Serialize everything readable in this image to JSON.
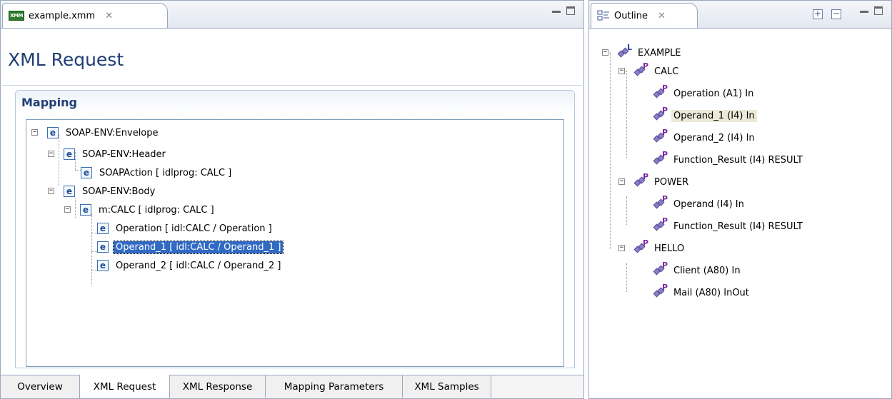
{
  "left_pane": {
    "tab_title": "example.xmm",
    "tab_icon": "XMM",
    "close_glyph": "✕",
    "editor_title": "XML Request",
    "section_title": "Mapping",
    "tree": [
      {
        "toggle": "−",
        "label": "SOAP-ENV:Envelope"
      },
      {
        "toggle": "−",
        "label": "SOAP-ENV:Header"
      },
      {
        "toggle": "",
        "label": "SOAPAction  [ idlprog: CALC ]"
      },
      {
        "toggle": "−",
        "label": "SOAP-ENV:Body"
      },
      {
        "toggle": "−",
        "label": "m:CALC  [ idlprog: CALC ]"
      },
      {
        "toggle": "",
        "label": "Operation  [ idl:CALC / Operation ]"
      },
      {
        "toggle": "",
        "label": "Operand_1  [ idl:CALC / Operand_1 ]",
        "selected": true
      },
      {
        "toggle": "",
        "label": "Operand_2  [ idl:CALC / Operand_2 ]"
      }
    ],
    "element_icon_letter": "e",
    "bottom_tabs": [
      "Overview",
      "XML Request",
      "XML Response",
      "Mapping Parameters",
      "XML Samples"
    ],
    "active_bottom_tab": "XML Request"
  },
  "outline_pane": {
    "tab_title": "Outline",
    "close_glyph": "✕",
    "expand_all_glyph": "+",
    "collapse_all_glyph": "−",
    "tree": [
      {
        "label": "EXAMPLE",
        "badge": "L",
        "toggle": "−"
      },
      {
        "label": "CALC",
        "badge": "P",
        "toggle": "−"
      },
      {
        "label": "Operation  (A1) In",
        "badge": "P"
      },
      {
        "label": "Operand_1  (I4) In",
        "badge": "P",
        "highlighted": true
      },
      {
        "label": "Operand_2  (I4) In",
        "badge": "P"
      },
      {
        "label": "Function_Result  (I4) RESULT",
        "badge": "P"
      },
      {
        "label": "POWER",
        "badge": "P",
        "toggle": "−"
      },
      {
        "label": "Operand  (I4) In",
        "badge": "P"
      },
      {
        "label": "Function_Result  (I4) RESULT",
        "badge": "P"
      },
      {
        "label": "HELLO",
        "badge": "P",
        "toggle": "−"
      },
      {
        "label": "Client  (A80) In",
        "badge": "P"
      },
      {
        "label": "Mail  (A80) InOut",
        "badge": "P"
      }
    ]
  },
  "colors": {
    "selection": "#316ac5",
    "title": "#1f3e74",
    "border": "#9aa8bf",
    "highlight": "#ece9d8"
  },
  "icons": {
    "editor_tab": "xmm-file-icon",
    "outline_tab": "outline-icon",
    "tree_node": "element-e-icon",
    "outline_node": "diamond-p-icon"
  }
}
